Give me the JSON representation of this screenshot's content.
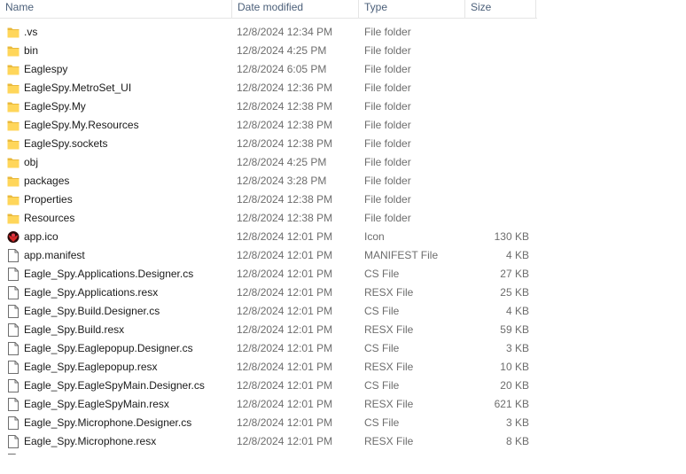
{
  "columns": {
    "name": "Name",
    "date": "Date modified",
    "type": "Type",
    "size": "Size"
  },
  "colors": {
    "folder": "#ffd65a",
    "folder_tab": "#e9b93b",
    "header_text": "#4c607a",
    "secondary_text": "#6d6d6d"
  },
  "files": [
    {
      "name": ".vs",
      "date": "12/8/2024 12:34 PM",
      "type": "File folder",
      "size": "",
      "icon": "folder-icon"
    },
    {
      "name": "bin",
      "date": "12/8/2024 4:25 PM",
      "type": "File folder",
      "size": "",
      "icon": "folder-icon"
    },
    {
      "name": "Eaglespy",
      "date": "12/8/2024 6:05 PM",
      "type": "File folder",
      "size": "",
      "icon": "folder-icon"
    },
    {
      "name": "EagleSpy.MetroSet_UI",
      "date": "12/8/2024 12:36 PM",
      "type": "File folder",
      "size": "",
      "icon": "folder-icon"
    },
    {
      "name": "EagleSpy.My",
      "date": "12/8/2024 12:38 PM",
      "type": "File folder",
      "size": "",
      "icon": "folder-icon"
    },
    {
      "name": "EagleSpy.My.Resources",
      "date": "12/8/2024 12:38 PM",
      "type": "File folder",
      "size": "",
      "icon": "folder-icon"
    },
    {
      "name": "EagleSpy.sockets",
      "date": "12/8/2024 12:38 PM",
      "type": "File folder",
      "size": "",
      "icon": "folder-icon"
    },
    {
      "name": "obj",
      "date": "12/8/2024 4:25 PM",
      "type": "File folder",
      "size": "",
      "icon": "folder-icon"
    },
    {
      "name": "packages",
      "date": "12/8/2024 3:28 PM",
      "type": "File folder",
      "size": "",
      "icon": "folder-icon"
    },
    {
      "name": "Properties",
      "date": "12/8/2024 12:38 PM",
      "type": "File folder",
      "size": "",
      "icon": "folder-icon"
    },
    {
      "name": "Resources",
      "date": "12/8/2024 12:38 PM",
      "type": "File folder",
      "size": "",
      "icon": "folder-icon"
    },
    {
      "name": "app.ico",
      "date": "12/8/2024 12:01 PM",
      "type": "Icon",
      "size": "130 KB",
      "icon": "eagle-logo-icon"
    },
    {
      "name": "app.manifest",
      "date": "12/8/2024 12:01 PM",
      "type": "MANIFEST File",
      "size": "4 KB",
      "icon": "file-icon"
    },
    {
      "name": "Eagle_Spy.Applications.Designer.cs",
      "date": "12/8/2024 12:01 PM",
      "type": "CS File",
      "size": "27 KB",
      "icon": "file-icon"
    },
    {
      "name": "Eagle_Spy.Applications.resx",
      "date": "12/8/2024 12:01 PM",
      "type": "RESX File",
      "size": "25 KB",
      "icon": "file-icon"
    },
    {
      "name": "Eagle_Spy.Build.Designer.cs",
      "date": "12/8/2024 12:01 PM",
      "type": "CS File",
      "size": "4 KB",
      "icon": "file-icon"
    },
    {
      "name": "Eagle_Spy.Build.resx",
      "date": "12/8/2024 12:01 PM",
      "type": "RESX File",
      "size": "59 KB",
      "icon": "file-icon"
    },
    {
      "name": "Eagle_Spy.Eaglepopup.Designer.cs",
      "date": "12/8/2024 12:01 PM",
      "type": "CS File",
      "size": "3 KB",
      "icon": "file-icon"
    },
    {
      "name": "Eagle_Spy.Eaglepopup.resx",
      "date": "12/8/2024 12:01 PM",
      "type": "RESX File",
      "size": "10 KB",
      "icon": "file-icon"
    },
    {
      "name": "Eagle_Spy.EagleSpyMain.Designer.cs",
      "date": "12/8/2024 12:01 PM",
      "type": "CS File",
      "size": "20 KB",
      "icon": "file-icon"
    },
    {
      "name": "Eagle_Spy.EagleSpyMain.resx",
      "date": "12/8/2024 12:01 PM",
      "type": "RESX File",
      "size": "621 KB",
      "icon": "file-icon"
    },
    {
      "name": "Eagle_Spy.Microphone.Designer.cs",
      "date": "12/8/2024 12:01 PM",
      "type": "CS File",
      "size": "3 KB",
      "icon": "file-icon"
    },
    {
      "name": "Eagle_Spy.Microphone.resx",
      "date": "12/8/2024 12:01 PM",
      "type": "RESX File",
      "size": "8 KB",
      "icon": "file-icon"
    }
  ]
}
